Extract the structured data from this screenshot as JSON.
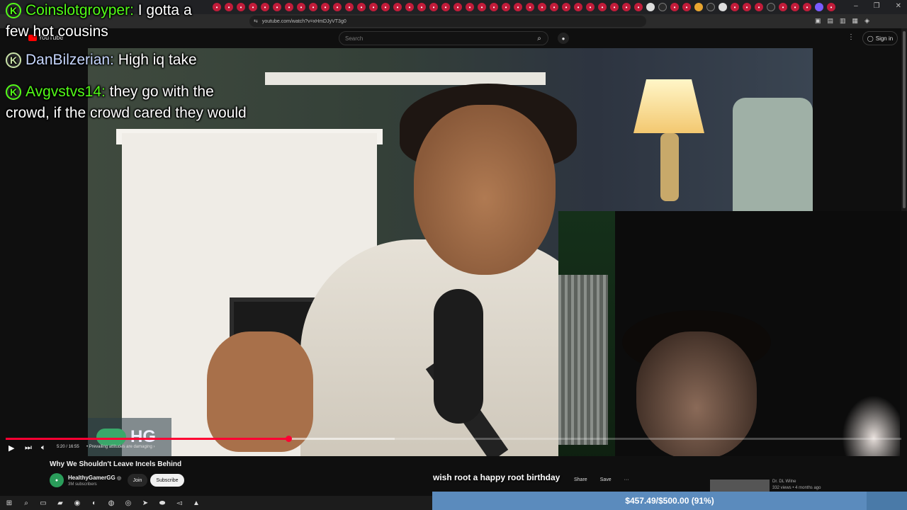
{
  "browser": {
    "url": "youtube.com/watch?v=xHmDJyVT3g0",
    "window_controls": [
      "–",
      "❐",
      "✕"
    ]
  },
  "youtube": {
    "logo_text": "YouTube",
    "search_placeholder": "Search",
    "sign_in": "Sign in",
    "video_title": "Why We Shouldn't Leave Incels Behind",
    "channel_name": "HealthyGamerGG",
    "verified_mark": "◎",
    "subscribers": "3M subscribers",
    "join_label": "Join",
    "subscribe_label": "Subscribe",
    "time": "5:20 / 16:55",
    "chapter": "• Prevailing attitudes are damaging ›",
    "actions": [
      "Share",
      "Save",
      "···"
    ],
    "rec_channel": "Dr. DL Wilne",
    "rec_meta": "332 views • 4 months ago",
    "progress_played": 0.316,
    "progress_buffered": 0.434,
    "brand_mark": "HG"
  },
  "chat": [
    {
      "user": "Coinslotgroyper:",
      "text": " I gotta a few hot cousins",
      "badge": "K",
      "user_color": "#53fc18"
    },
    {
      "user": "DanBilzerian:",
      "text": " High iq take",
      "badge": "K",
      "user_color": "#c7d7ff"
    },
    {
      "user": "Avgvstvs14:",
      "text": " they go with the crowd, if the crowd cared they would",
      "badge": "K",
      "user_color": "#53fc18"
    }
  ],
  "overlay": {
    "message": "wish root a happy root birthday",
    "goal_text": "$457.49/$500.00 (91%)",
    "goal_fraction": 0.915
  },
  "taskbar": {
    "icons": [
      "windows-icon",
      "search-icon",
      "task-view-icon",
      "file-explorer-icon",
      "obs-icon",
      "discord-icon",
      "steam-icon",
      "chrome-icon",
      "telegram-icon",
      "vpn-icon",
      "volume-icon",
      "brave-icon"
    ]
  },
  "colors": {
    "kick_green": "#53fc18",
    "yt_red": "#ff0033",
    "goal_blue": "#4a7aa8"
  }
}
